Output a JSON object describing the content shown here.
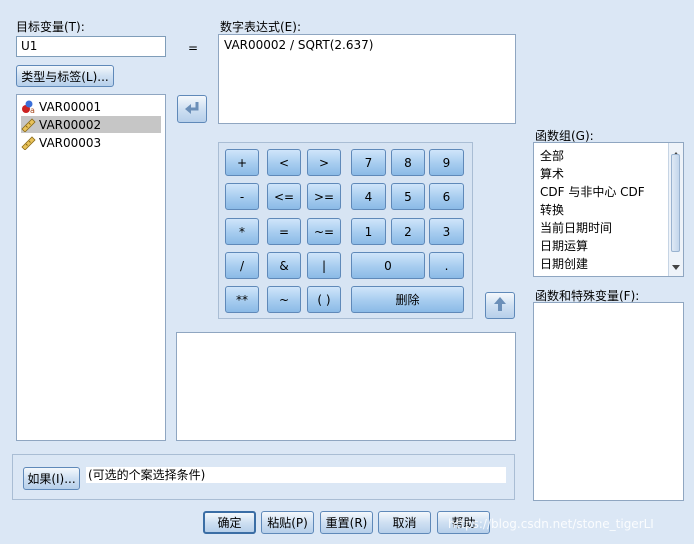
{
  "target": {
    "label": "目标变量(T):",
    "value": "U1"
  },
  "equals": "=",
  "type_label_button": "类型与标签(L)...",
  "variables": [
    "VAR00001",
    "VAR00002",
    "VAR00003"
  ],
  "expression": {
    "label": "数字表达式(E):",
    "value": "VAR00002 / SQRT(2.637)"
  },
  "keypad": {
    "ops": [
      "+",
      "<",
      ">",
      "-",
      "<=",
      ">=",
      "*",
      "=",
      "~=",
      "/",
      "&",
      "|",
      "**",
      "~",
      "( )"
    ],
    "digits": [
      "7",
      "8",
      "9",
      "4",
      "5",
      "6",
      "1",
      "2",
      "3",
      "0",
      "."
    ],
    "delete": "删除"
  },
  "function_group": {
    "label": "函数组(G):",
    "items": [
      "全部",
      "算术",
      "CDF 与非中心 CDF",
      "转换",
      "当前日期时间",
      "日期运算",
      "日期创建"
    ]
  },
  "functions_label": "函数和特殊变量(F):",
  "if_button": "如果(I)...",
  "if_condition": "(可选的个案选择条件)",
  "buttons": {
    "ok": "确定",
    "paste": "粘贴(P)",
    "reset": "重置(R)",
    "cancel": "取消",
    "help": "帮助"
  },
  "watermark": "https://blog.csdn.net/stone_tigerLI"
}
